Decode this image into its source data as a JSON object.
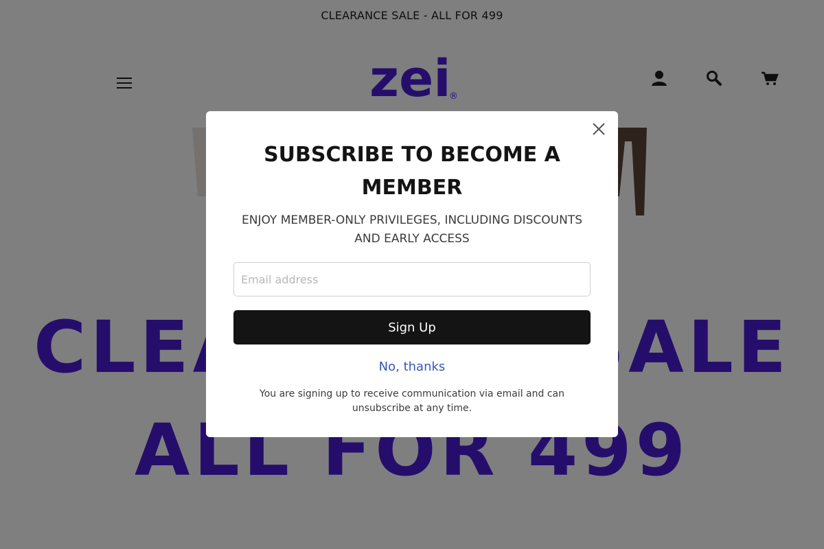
{
  "announcement": {
    "text": "CLEARANCE SALE - ALL FOR 499"
  },
  "header": {
    "logo_text": "zei",
    "logo_mark": "®",
    "icons": [
      "menu-icon",
      "account-icon",
      "search-icon",
      "cart-icon"
    ]
  },
  "hero": {
    "line1": "CLEARANCE SALE",
    "line2": "ALL FOR 499"
  },
  "popup": {
    "title": "SUBSCRIBE TO BECOME A MEMBER",
    "subtitle": "ENJOY MEMBER-ONLY PRIVILEGES, INCLUDING DISCOUNTS AND EARLY ACCESS",
    "email_placeholder": "Email address",
    "email_value": "",
    "signup_label": "Sign Up",
    "decline_label": "No, thanks",
    "disclaimer": "You are signing up to receive communication via email and can unsubscribe at any time."
  },
  "colors": {
    "brand": "#4a1dd6",
    "button_bg": "#141414",
    "link": "#3457b8",
    "overlay": "rgba(0,0,0,0.5)"
  }
}
